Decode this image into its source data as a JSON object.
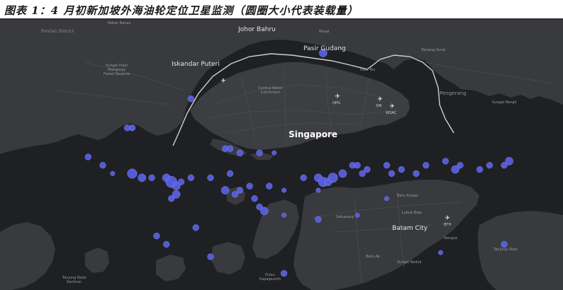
{
  "caption": "图表 1：4 月初新加坡外海油轮定位卫星监测（圆圈大小代表装载量）",
  "map_labels": {
    "johor_bahru": "Johor Bahru",
    "pasir_gudang": "Pasir Gudang",
    "iskandar_puteri": "Iskandar Puteri",
    "singapore": "Singapore",
    "batam_city": "Batam City",
    "pontian_district": "Pontian District",
    "pekan_nanas": "Pekan Nanas",
    "masai": "Masai",
    "tanjung_surat": "Tanjung Surat",
    "pengerang": "Pengerang",
    "sungai_rengit": "Sungai Rengit",
    "sungai_pulai": "Sungai Pulai\nMangrove\nForest Reserve",
    "central_water": "Central Water\nCatchment",
    "batu_ampar": "Batu Ampar",
    "sekupang": "Sekupang",
    "lubuk_baja": "Lubuk Baja",
    "nongsa": "Nongsa",
    "tanjung_uban": "Tanjung Uban",
    "batu_aji": "Batu Aji",
    "sungai_beduk": "Sungai Beduk",
    "tanjung_balai_karimun": "Tanjung Balai\nKarimun",
    "pulau_kapaipuntih": "Pulau\nKapaipuntih",
    "pasir_ris": "Pasir Ris"
  },
  "airports": {
    "qpg": "QPG",
    "sin": "SIN",
    "wsac": "WSAC",
    "bth": "BTH"
  },
  "colors": {
    "water": "#1f2023",
    "land": "#3a3b3f",
    "roads": "#4b4c50",
    "border": "#c8c8c8",
    "tanker": "#5b62e6"
  },
  "tankers": [
    {
      "lon": 104.06,
      "lat": 1.47,
      "size": 3
    },
    {
      "lon": 103.79,
      "lat": 1.36,
      "size": 2
    },
    {
      "lon": 103.86,
      "lat": 1.24,
      "size": 2
    },
    {
      "lon": 103.87,
      "lat": 1.24,
      "size": 2
    },
    {
      "lon": 103.89,
      "lat": 1.23,
      "size": 2
    },
    {
      "lon": 103.93,
      "lat": 1.23,
      "size": 2
    },
    {
      "lon": 103.96,
      "lat": 1.23,
      "size": 1
    },
    {
      "lon": 103.58,
      "lat": 1.22,
      "size": 2
    },
    {
      "lon": 103.61,
      "lat": 1.2,
      "size": 2
    },
    {
      "lon": 103.63,
      "lat": 1.18,
      "size": 1
    },
    {
      "lon": 103.67,
      "lat": 1.18,
      "size": 4
    },
    {
      "lon": 103.69,
      "lat": 1.17,
      "size": 3
    },
    {
      "lon": 103.71,
      "lat": 1.17,
      "size": 2
    },
    {
      "lon": 103.74,
      "lat": 1.17,
      "size": 3
    },
    {
      "lon": 103.75,
      "lat": 1.16,
      "size": 5
    },
    {
      "lon": 103.76,
      "lat": 1.15,
      "size": 3
    },
    {
      "lon": 103.77,
      "lat": 1.16,
      "size": 2
    },
    {
      "lon": 103.79,
      "lat": 1.17,
      "size": 2
    },
    {
      "lon": 103.76,
      "lat": 1.13,
      "size": 3
    },
    {
      "lon": 103.75,
      "lat": 1.12,
      "size": 2
    },
    {
      "lon": 103.83,
      "lat": 1.17,
      "size": 2
    },
    {
      "lon": 103.86,
      "lat": 1.14,
      "size": 3
    },
    {
      "lon": 103.88,
      "lat": 1.13,
      "size": 2
    },
    {
      "lon": 103.89,
      "lat": 1.14,
      "size": 2
    },
    {
      "lon": 103.91,
      "lat": 1.15,
      "size": 2
    },
    {
      "lon": 103.92,
      "lat": 1.12,
      "size": 2
    },
    {
      "lon": 103.95,
      "lat": 1.15,
      "size": 2
    },
    {
      "lon": 103.98,
      "lat": 1.14,
      "size": 1
    },
    {
      "lon": 104.02,
      "lat": 1.17,
      "size": 2
    },
    {
      "lon": 104.05,
      "lat": 1.17,
      "size": 3
    },
    {
      "lon": 104.06,
      "lat": 1.16,
      "size": 4
    },
    {
      "lon": 104.07,
      "lat": 1.16,
      "size": 3
    },
    {
      "lon": 104.08,
      "lat": 1.17,
      "size": 4
    },
    {
      "lon": 104.1,
      "lat": 1.18,
      "size": 3
    },
    {
      "lon": 104.12,
      "lat": 1.2,
      "size": 2
    },
    {
      "lon": 104.13,
      "lat": 1.2,
      "size": 2
    },
    {
      "lon": 104.15,
      "lat": 1.19,
      "size": 2
    },
    {
      "lon": 104.14,
      "lat": 1.18,
      "size": 2
    },
    {
      "lon": 104.19,
      "lat": 1.2,
      "size": 2
    },
    {
      "lon": 104.2,
      "lat": 1.18,
      "size": 2
    },
    {
      "lon": 104.22,
      "lat": 1.19,
      "size": 2
    },
    {
      "lon": 104.25,
      "lat": 1.18,
      "size": 2
    },
    {
      "lon": 104.27,
      "lat": 1.2,
      "size": 2
    },
    {
      "lon": 104.31,
      "lat": 1.21,
      "size": 2
    },
    {
      "lon": 104.33,
      "lat": 1.19,
      "size": 3
    },
    {
      "lon": 104.34,
      "lat": 1.2,
      "size": 2
    },
    {
      "lon": 104.38,
      "lat": 1.19,
      "size": 2
    },
    {
      "lon": 104.4,
      "lat": 1.2,
      "size": 2
    },
    {
      "lon": 104.43,
      "lat": 1.2,
      "size": 2
    },
    {
      "lon": 104.44,
      "lat": 1.21,
      "size": 3
    },
    {
      "lon": 103.67,
      "lat": 1.29,
      "size": 2
    },
    {
      "lon": 103.66,
      "lat": 1.29,
      "size": 2
    },
    {
      "lon": 103.87,
      "lat": 1.18,
      "size": 2
    },
    {
      "lon": 103.94,
      "lat": 1.09,
      "size": 3
    },
    {
      "lon": 103.93,
      "lat": 1.1,
      "size": 2
    },
    {
      "lon": 103.98,
      "lat": 1.08,
      "size": 1
    },
    {
      "lon": 104.05,
      "lat": 1.07,
      "size": 2
    },
    {
      "lon": 103.8,
      "lat": 1.05,
      "size": 2
    },
    {
      "lon": 103.83,
      "lat": 0.98,
      "size": 2
    },
    {
      "lon": 103.72,
      "lat": 1.03,
      "size": 2
    },
    {
      "lon": 103.74,
      "lat": 1.01,
      "size": 2
    },
    {
      "lon": 103.98,
      "lat": 0.94,
      "size": 2
    },
    {
      "lon": 104.3,
      "lat": 0.99,
      "size": 1
    },
    {
      "lon": 104.43,
      "lat": 1.01,
      "size": 2
    },
    {
      "lon": 104.13,
      "lat": 1.08,
      "size": 1
    },
    {
      "lon": 104.19,
      "lat": 1.12,
      "size": 1
    },
    {
      "lon": 104.05,
      "lat": 1.14,
      "size": 1
    }
  ]
}
